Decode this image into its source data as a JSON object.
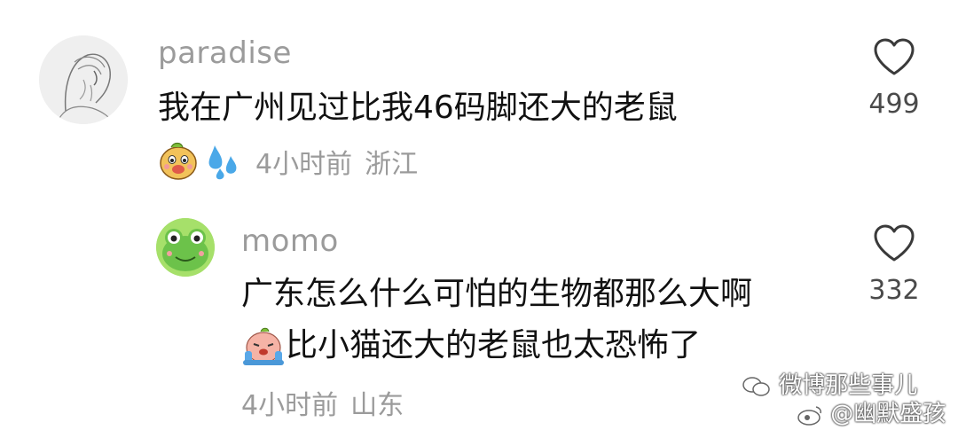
{
  "comments": [
    {
      "username": "paradise",
      "text": "我在广州见过比我46码脚还大的老鼠",
      "reactions": [
        "dog-face-sticker",
        "sweat-drops-emoji"
      ],
      "time": "4小时前",
      "location": "浙江",
      "likes": "499",
      "avatar": "sketch-portrait"
    },
    {
      "username": "momo",
      "text_line1": "广东怎么什么可怕的生物都那么大啊",
      "text_line2": "比小猫还大的老鼠也太恐怖了",
      "inline_emoji": "crying-peach-sticker",
      "time": "4小时前",
      "location": "山东",
      "likes": "332",
      "avatar": "green-frog"
    }
  ],
  "watermark": {
    "line1": "微博那些事儿",
    "line2": "@幽默盛孩"
  },
  "colors": {
    "meta_gray": "#9b9b9b",
    "text": "#111111",
    "frog_green": "#6cc24a"
  }
}
